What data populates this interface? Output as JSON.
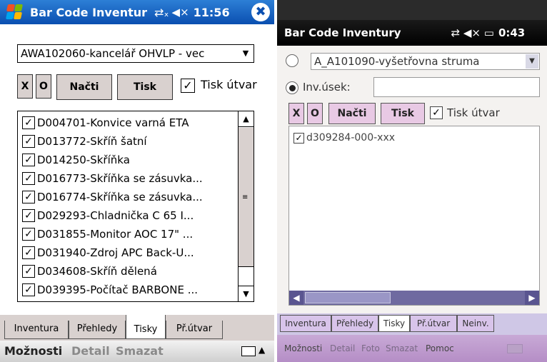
{
  "left": {
    "titlebar": {
      "title": "Bar Code Inventur",
      "connectivity": "⇄ₓ",
      "volume": "◀×",
      "time": "11:56",
      "close": "✖"
    },
    "combo": {
      "value": "AWA102060-kancelář OHVLP - vec"
    },
    "buttons": {
      "x": "X",
      "o": "O",
      "nacti": "Načti",
      "tisk": "Tisk"
    },
    "checkbox": {
      "label": "Tisk útvar",
      "checked": true
    },
    "list_items": [
      "D004701-Konvice varná ETA",
      "D013772-Skříň šatní",
      "D014250-Skříňka",
      "D016773-Skříňka se zásuvka...",
      "D016774-Skříňka se zásuvka...",
      "D029293-Chladnička C 65 I...",
      "D031855-Monitor AOC 17\" ...",
      "D031940-Zdroj APC Back-U...",
      "D034608-Skříň dělená",
      "D039395-Počítač BARBONE ..."
    ],
    "tabs": [
      "Inventura",
      "Přehledy",
      "Tisky",
      "Př.útvar"
    ],
    "active_tab": "Tisky",
    "menu": {
      "moznosti": "Možnosti",
      "detail": "Detail",
      "smazat": "Smazat"
    }
  },
  "right": {
    "titlebar": {
      "title": "Bar Code Inventury",
      "icons": "⇄ ◀× ▭",
      "time": "0:43"
    },
    "combo": {
      "value": "A_A101090-vyšetřovna struma"
    },
    "inv_usek_label": "Inv.úsek:",
    "buttons": {
      "x": "X",
      "o": "O",
      "nacti": "Načti",
      "tisk": "Tisk"
    },
    "checkbox": {
      "label": "Tisk útvar",
      "checked": true
    },
    "list_items": [
      "d309284-000-xxx"
    ],
    "tabs": [
      "Inventura",
      "Přehledy",
      "Tisky",
      "Př.útvar",
      "Neinv."
    ],
    "active_tab": "Tisky",
    "menu": {
      "moznosti": "Možnosti",
      "detail": "Detail",
      "foto": "Foto",
      "smazat": "Smazat",
      "pomoc": "Pomoc"
    }
  },
  "colors": {
    "left_titlebar": "#0a4fb0",
    "button_face": "#d9d1cf",
    "right_button_face": "#e8c9e4",
    "right_menubar": "#b58ec6"
  }
}
